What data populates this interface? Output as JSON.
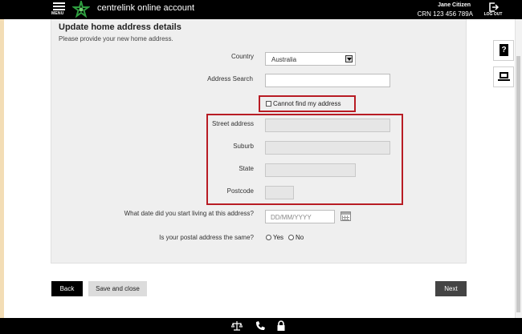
{
  "header": {
    "menu_label": "MENU",
    "app_title": "centrelink online account",
    "user_name": "Jane Citizen",
    "crn": "CRN 123 456 789A",
    "logout_label": "LOG OUT"
  },
  "form": {
    "title": "Update home address details",
    "subtitle": "Please provide your new home address.",
    "country_label": "Country",
    "country_value": "Australia",
    "search_label": "Address Search",
    "search_value": "",
    "cannot_find_label": "Cannot find my address",
    "street_label": "Street address",
    "suburb_label": "Suburb",
    "state_label": "State",
    "postcode_label": "Postcode",
    "date_label": "What date did you start living at this address?",
    "date_placeholder": "DD/MM/YYYY",
    "postal_label": "Is your postal address the same?",
    "yes_label": "Yes",
    "no_label": "No"
  },
  "buttons": {
    "back": "Back",
    "save_close": "Save and close",
    "next": "Next"
  },
  "side_icons": [
    "help-icon",
    "laptop-icon"
  ],
  "footer_icons": [
    "scales-icon",
    "phone-icon",
    "lock-icon"
  ],
  "colors": {
    "highlight_box": "#b81c24",
    "topbar": "#000000",
    "panel_bg": "#efefef",
    "logo_green": "#2e9e3f"
  }
}
